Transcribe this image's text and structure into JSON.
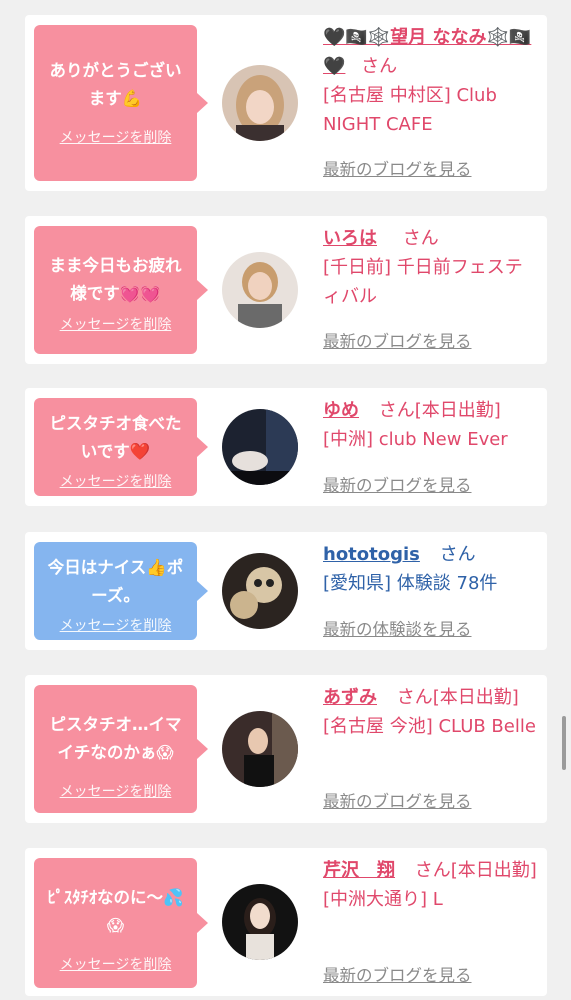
{
  "cards": [
    {
      "message": "ありがとうございます💪",
      "delete_label": "メッセージを削除",
      "bubble_color": "pink",
      "name": "🖤🏴‍☠️🕸️望月 ななみ🕸️🏴‍☠️🖤",
      "honorific": "さん",
      "status": "",
      "shop": "[名古屋 中村区] Club NIGHT CAFE",
      "link": "最新のブログを見る",
      "avatar_icon": "avatar-photo-icon"
    },
    {
      "message": "まま今日もお疲れ様です💓💓",
      "delete_label": "メッセージを削除",
      "bubble_color": "pink",
      "name": "いろは",
      "honorific": "さん",
      "status": "",
      "shop": "[千日前] 千日前フェスティバル",
      "link": "最新のブログを見る",
      "avatar_icon": "avatar-photo-icon"
    },
    {
      "message": "ピスタチオ食べたいです❤️",
      "delete_label": "メッセージを削除",
      "bubble_color": "pink",
      "name": "ゆめ",
      "honorific": "さん",
      "status": "[本日出勤]",
      "shop": "[中洲] club New Ever",
      "link": "最新のブログを見る",
      "avatar_icon": "avatar-photo-icon"
    },
    {
      "message": "今日はナイス👍ポーズ。",
      "delete_label": "メッセージを削除",
      "bubble_color": "blue",
      "name": "hototogis",
      "honorific": "さん",
      "status": "",
      "shop": "[愛知県] 体験談 78件",
      "link": "最新の体験談を見る",
      "avatar_icon": "avatar-photo-icon"
    },
    {
      "message": "ピスタチオ…イマイチなのかぁ😱",
      "delete_label": "メッセージを削除",
      "bubble_color": "pink",
      "name": "あずみ",
      "honorific": "さん",
      "status": "[本日出勤]",
      "shop": "[名古屋 今池] CLUB Belle",
      "link": "最新のブログを見る",
      "avatar_icon": "avatar-photo-icon"
    },
    {
      "message": "ﾋﾟｽﾀﾁｵなのに〜💦😱",
      "delete_label": "メッセージを削除",
      "bubble_color": "pink",
      "name": "芹沢　翔",
      "honorific": "さん",
      "status": "[本日出勤]",
      "shop": "[中洲大通り] L",
      "link": "最新のブログを見る",
      "avatar_icon": "avatar-photo-icon"
    }
  ],
  "colors": {
    "bubble_pink": "#f7909f",
    "bubble_blue": "#85b5ef",
    "name_pink": "#e0486b",
    "name_blue": "#2f62a8",
    "link_gray": "#8a8a8a"
  }
}
